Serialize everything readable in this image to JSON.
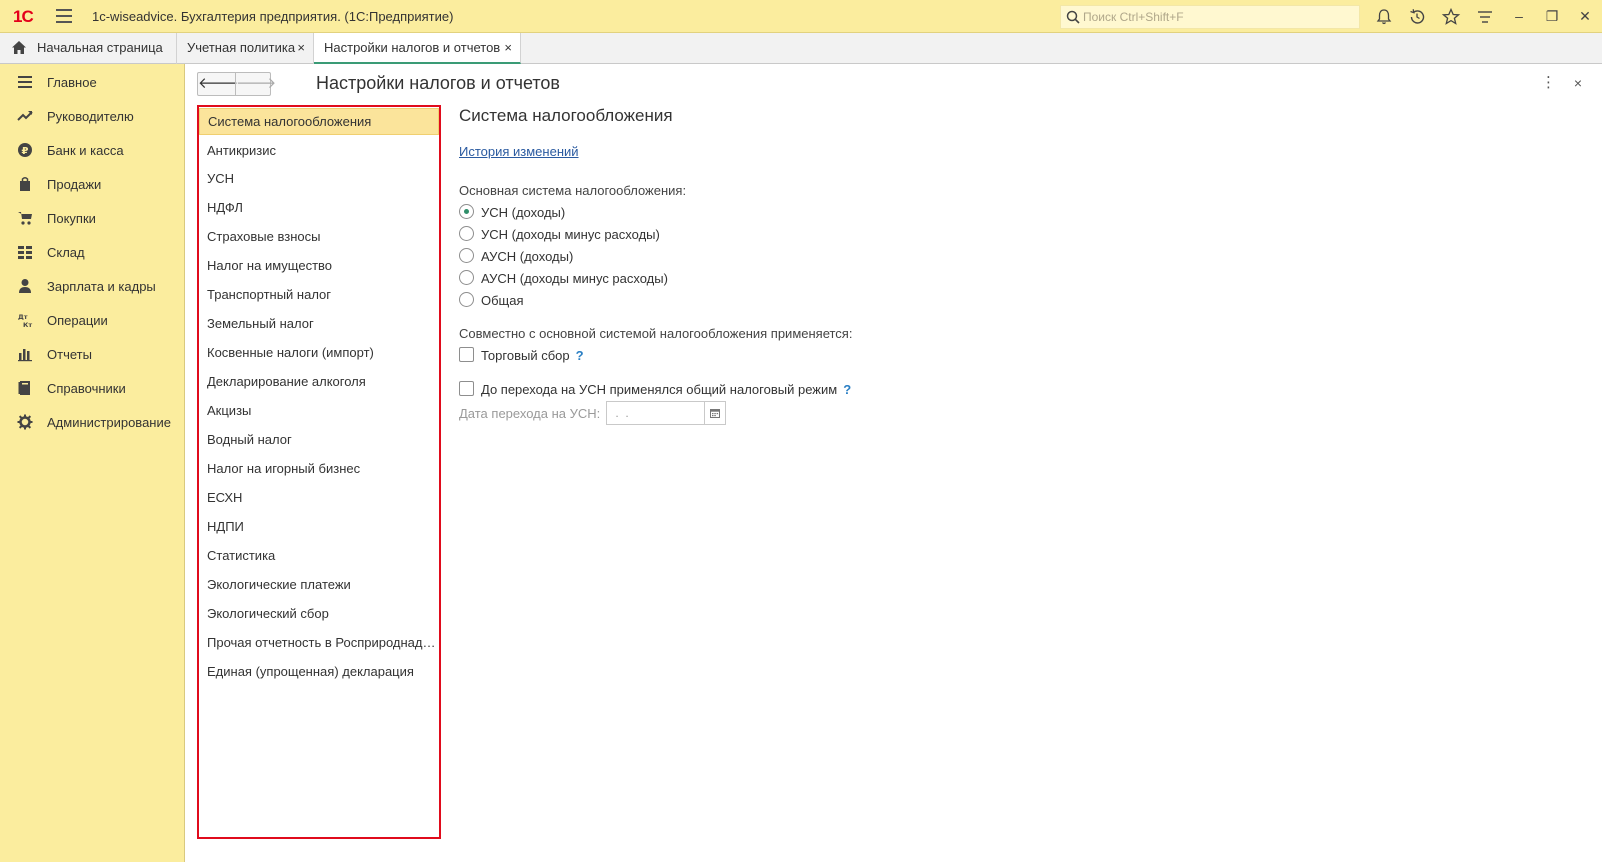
{
  "app": {
    "title": "1c-wiseadvice. Бухгалтерия предприятия.  (1С:Предприятие)",
    "logo": "1С",
    "search_placeholder": "Поиск Ctrl+Shift+F"
  },
  "tabs": [
    {
      "label": "Начальная страница",
      "icon": "home-icon"
    },
    {
      "label": "Учетная политика",
      "close": "×"
    },
    {
      "label": "Настройки налогов и отчетов",
      "close": "×",
      "active": true
    }
  ],
  "sidebar": {
    "items": [
      {
        "label": "Главное",
        "icon": "menu-lines-icon"
      },
      {
        "label": "Руководителю",
        "icon": "trend-icon"
      },
      {
        "label": "Банк и касса",
        "icon": "ruble-coin-icon"
      },
      {
        "label": "Продажи",
        "icon": "bag-icon"
      },
      {
        "label": "Покупки",
        "icon": "cart-icon"
      },
      {
        "label": "Склад",
        "icon": "warehouse-icon"
      },
      {
        "label": "Зарплата и кадры",
        "icon": "person-icon"
      },
      {
        "label": "Операции",
        "icon": "dt-kt-icon"
      },
      {
        "label": "Отчеты",
        "icon": "bar-chart-icon"
      },
      {
        "label": "Справочники",
        "icon": "book-icon"
      },
      {
        "label": "Администрирование",
        "icon": "gear-icon"
      }
    ]
  },
  "page": {
    "title": "Настройки налогов и отчетов",
    "back": "🡐",
    "forward": "🡒",
    "more": "⋮",
    "close": "×"
  },
  "sections": [
    "Система налогообложения",
    "Антикризис",
    "УСН",
    "НДФЛ",
    "Страховые взносы",
    "Налог на имущество",
    "Транспортный налог",
    "Земельный налог",
    "Косвенные налоги (импорт)",
    "Декларирование алкоголя",
    "Акцизы",
    "Водный налог",
    "Налог на игорный бизнес",
    "ЕСХН",
    "НДПИ",
    "Статистика",
    "Экологические платежи",
    "Экологический сбор",
    "Прочая отчетность в Росприроднадзор",
    "Единая (упрощенная) декларация"
  ],
  "panel": {
    "title": "Система налогообложения",
    "history_link": "История изменений",
    "main_system_label": "Основная система налогообложения:",
    "options": [
      {
        "label": "УСН (доходы)",
        "selected": true
      },
      {
        "label": "УСН (доходы минус расходы)",
        "selected": false
      },
      {
        "label": "АУСН (доходы)",
        "selected": false
      },
      {
        "label": "АУСН (доходы минус расходы)",
        "selected": false
      },
      {
        "label": "Общая",
        "selected": false
      }
    ],
    "joint_label": "Совместно с основной системой налогообложения применяется:",
    "trade_fee": {
      "label": "Торговый сбор",
      "help": "?",
      "checked": false
    },
    "prior_general": {
      "label": "До перехода на УСН применялся общий налоговый режим",
      "help": "?",
      "checked": false
    },
    "transition_date_label": "Дата перехода на УСН:",
    "transition_date_value": " .  ."
  }
}
